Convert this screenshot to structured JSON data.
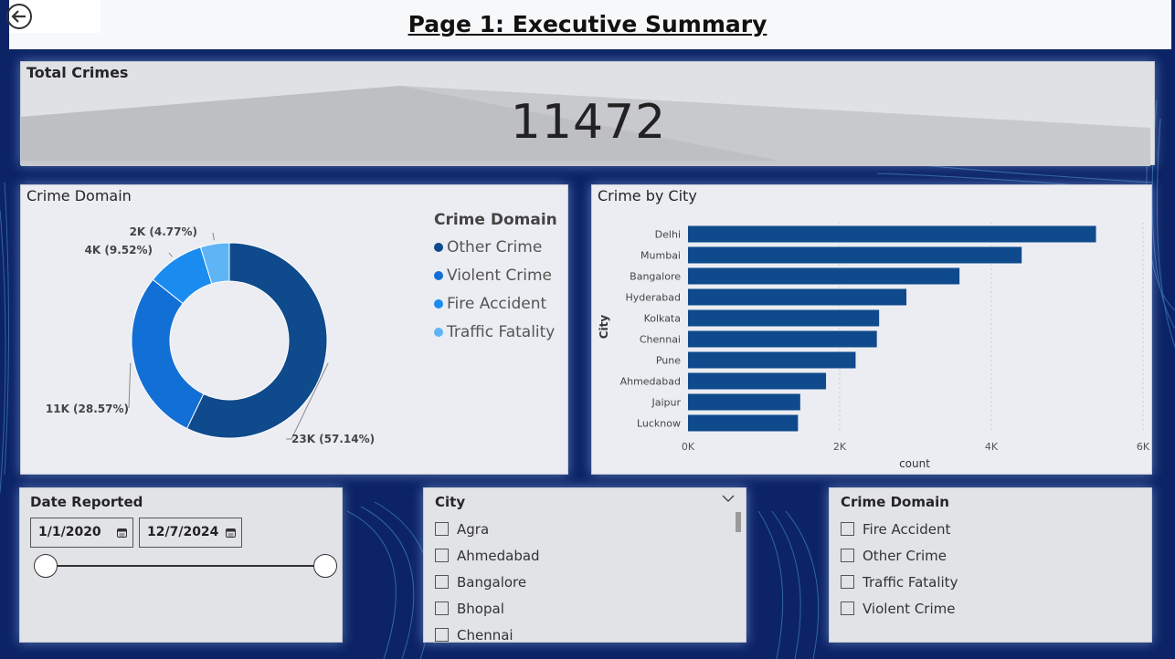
{
  "header": {
    "title": "Page 1: Executive Summary"
  },
  "kpi": {
    "title": "Total Crimes",
    "value": "11472"
  },
  "donut": {
    "title": "Crime Domain",
    "legend_title": "Crime Domain",
    "slices": [
      {
        "name": "Other Crime",
        "label": "23K (57.14%)",
        "pct": 57.14,
        "color": "#0e4a8c"
      },
      {
        "name": "Violent Crime",
        "label": "11K (28.57%)",
        "pct": 28.57,
        "color": "#126fd6"
      },
      {
        "name": "Fire Accident",
        "label": "4K (9.52%)",
        "pct": 9.52,
        "color": "#1a8cf0"
      },
      {
        "name": "Traffic Fatality",
        "label": "2K (4.77%)",
        "pct": 4.77,
        "color": "#5fb4f6"
      }
    ]
  },
  "chart_data": {
    "type": "bar",
    "title": "Crime by City",
    "xlabel": "count",
    "ylabel": "City",
    "categories": [
      "Delhi",
      "Mumbai",
      "Bangalore",
      "Hyderabad",
      "Kolkata",
      "Chennai",
      "Pune",
      "Ahmedabad",
      "Jaipur",
      "Lucknow"
    ],
    "values": [
      5380,
      4400,
      3580,
      2880,
      2520,
      2490,
      2210,
      1820,
      1480,
      1450
    ],
    "xlim": [
      0,
      6000
    ],
    "xticks": [
      "0K",
      "2K",
      "4K",
      "6K"
    ],
    "grid": true,
    "color": "#0e4a8c"
  },
  "date_slicer": {
    "title": "Date Reported",
    "start": "1/1/2020",
    "end": "12/7/2024"
  },
  "city_slicer": {
    "title": "City",
    "items": [
      "Agra",
      "Ahmedabad",
      "Bangalore",
      "Bhopal",
      "Chennai"
    ]
  },
  "domain_slicer": {
    "title": "Crime Domain",
    "items": [
      "Fire Accident",
      "Other Crime",
      "Traffic Fatality",
      "Violent Crime"
    ]
  }
}
